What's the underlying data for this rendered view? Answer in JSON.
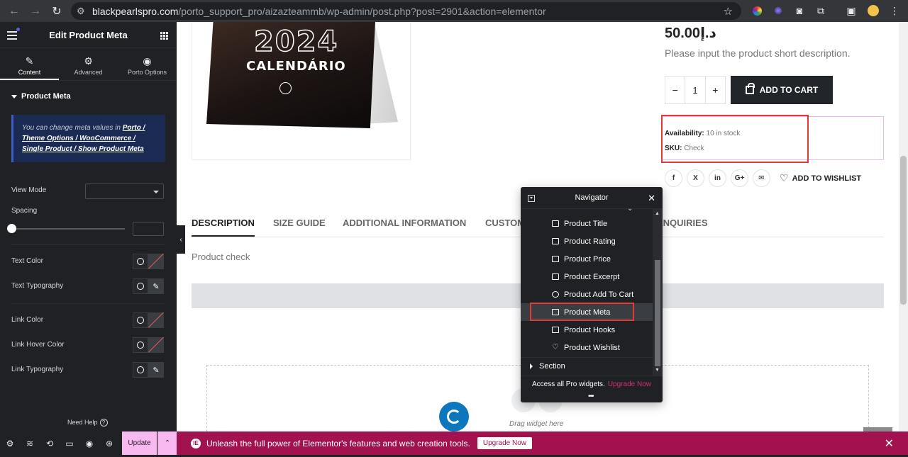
{
  "browser": {
    "url_host": "blackpearlspro.com",
    "url_path": "/porto_support_pro/aizazteammb/wp-admin/post.php?post=2901&action=elementor"
  },
  "panel": {
    "title": "Edit Product Meta",
    "tabs": [
      {
        "label": "Content",
        "icon": "pencil-icon"
      },
      {
        "label": "Advanced",
        "icon": "gear-icon"
      },
      {
        "label": "Porto Options",
        "icon": "circle-dot-icon"
      }
    ],
    "section_title": "Product Meta",
    "notice_text": "You can change meta values in ",
    "notice_link": "Porto / Theme Options / WooCommerce / Single Product / Show Product Meta",
    "controls": {
      "view_mode": "View Mode",
      "spacing": "Spacing",
      "text_color": "Text Color",
      "text_typography": "Text Typography",
      "link_color": "Link Color",
      "link_hover_color": "Link Hover Color",
      "link_typography": "Link Typography"
    },
    "need_help": "Need Help",
    "update_label": "Update"
  },
  "promo": {
    "text": "Unleash the full power of Elementor's features and web creation tools.",
    "button": "Upgrade Now"
  },
  "product": {
    "image_year": "2024",
    "image_word": "CALENDÁRIO",
    "price": "50.00د.إ",
    "excerpt": "Please input the product short description.",
    "qty": "1",
    "add_to_cart": "ADD TO CART",
    "availability_label": "Availability:",
    "availability_value": "10 in stock",
    "sku_label": "SKU:",
    "sku_value": "Check",
    "wishlist": "ADD TO WISHLIST",
    "share_icons": [
      "f",
      "X",
      "in",
      "G+",
      "✉"
    ]
  },
  "product_tabs": [
    "DESCRIPTION",
    "SIZE GUIDE",
    "ADDITIONAL INFORMATION",
    "CUSTOM",
    "ENQUIRIES"
  ],
  "description_text": "Product check",
  "drag_text": "Drag widget here",
  "navigator": {
    "title": "Navigator",
    "items": [
      "Product Title",
      "Product Rating",
      "Product Price",
      "Product Excerpt",
      "Product Add To Cart",
      "Product Meta",
      "Product Hooks",
      "Product Wishlist"
    ],
    "section": "Section",
    "promo_text": "Access all Pro widgets.",
    "promo_link": "Upgrade Now"
  },
  "colors": {
    "panel_bg": "#1f2124",
    "promo_bg": "#a1124e",
    "update_bg": "#f7b9f0",
    "highlight_red": "#e03a3a",
    "spinner_blue": "#0c77bd"
  }
}
